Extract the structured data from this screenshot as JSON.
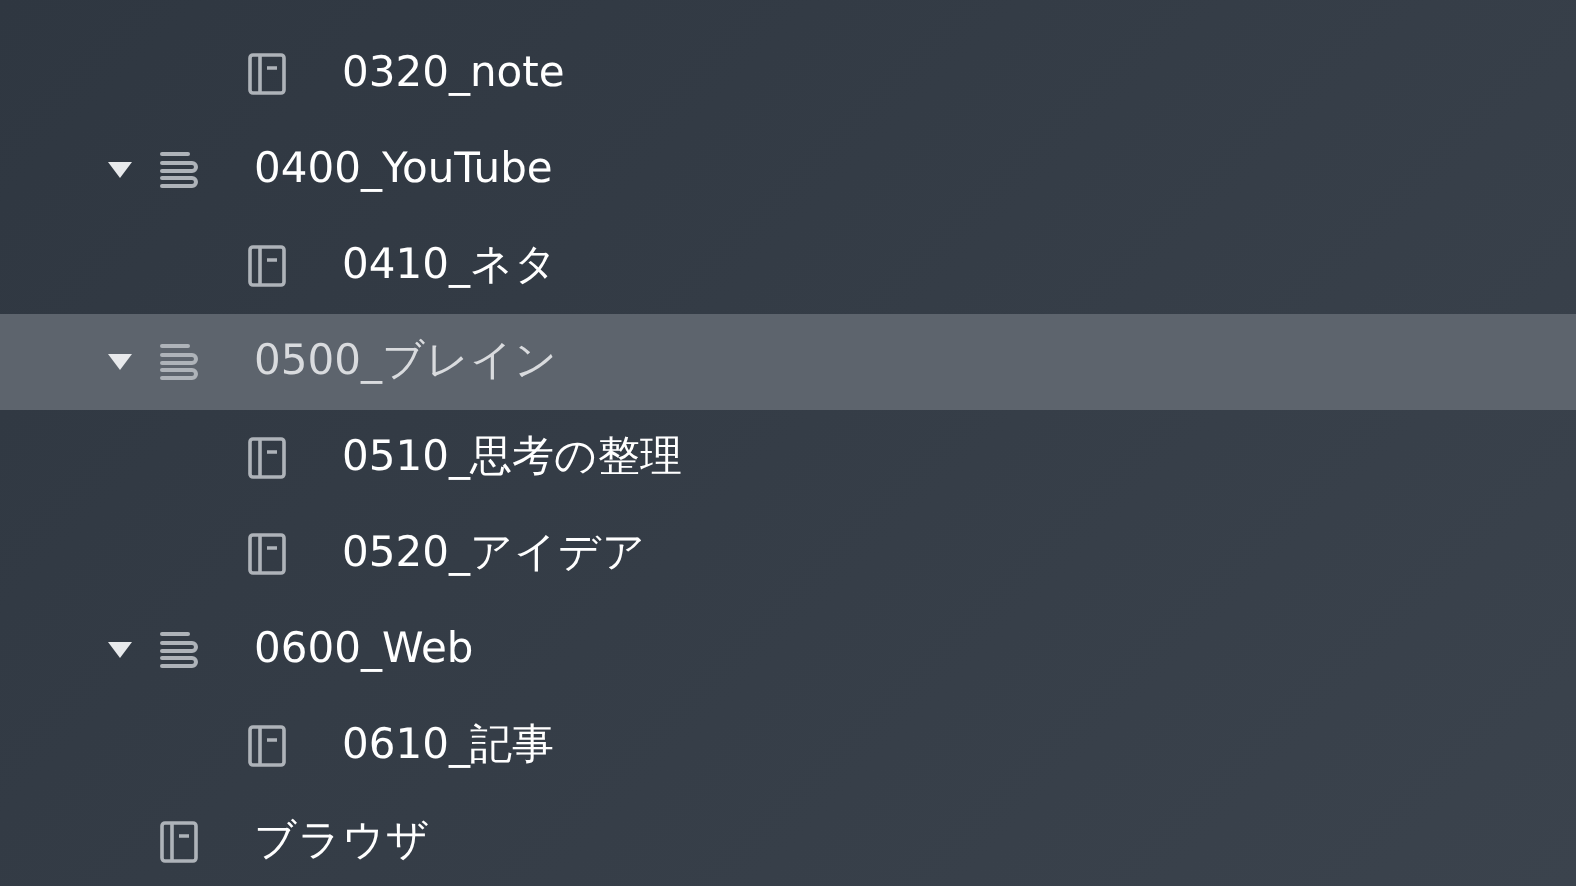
{
  "sidebar": {
    "items": [
      {
        "children": [
          {
            "kind": "notebook",
            "label": "0320_note",
            "selected": false
          }
        ]
      },
      {
        "kind": "stack",
        "label": "0400_YouTube",
        "expanded": true,
        "selected": false,
        "children": [
          {
            "kind": "notebook",
            "label": "0410_ネタ",
            "selected": false
          }
        ]
      },
      {
        "kind": "stack",
        "label": "0500_ブレイン",
        "expanded": true,
        "selected": true,
        "children": [
          {
            "kind": "notebook",
            "label": "0510_思考の整理",
            "selected": false
          },
          {
            "kind": "notebook",
            "label": "0520_アイデア",
            "selected": false
          }
        ]
      },
      {
        "kind": "stack",
        "label": "0600_Web",
        "expanded": true,
        "selected": false,
        "children": [
          {
            "kind": "notebook",
            "label": "0610_記事",
            "selected": false
          }
        ]
      },
      {
        "kind": "notebook",
        "label": "ブラウザ",
        "selected": false
      }
    ]
  }
}
